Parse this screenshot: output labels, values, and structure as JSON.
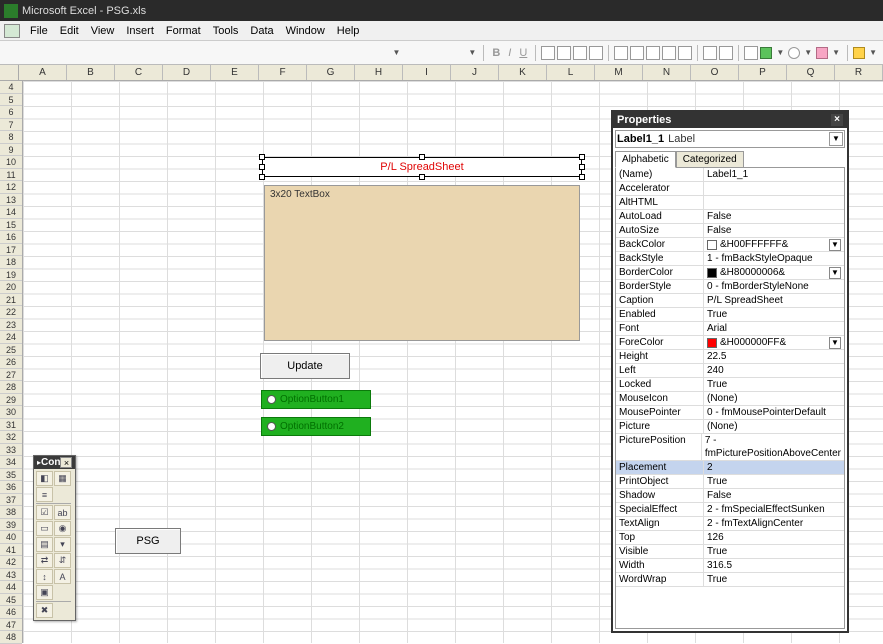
{
  "titlebar": {
    "text": "Microsoft Excel - PSG.xls"
  },
  "menus": [
    "File",
    "Edit",
    "View",
    "Insert",
    "Format",
    "Tools",
    "Data",
    "Window",
    "Help"
  ],
  "columns": [
    "A",
    "B",
    "C",
    "D",
    "E",
    "F",
    "G",
    "H",
    "I",
    "J",
    "K",
    "L",
    "M",
    "N",
    "O",
    "P",
    "Q",
    "R"
  ],
  "row_start": 4,
  "row_end": 48,
  "design": {
    "label_caption": "P/L SpreadSheet",
    "textbox_text": "3x20 TextBox",
    "update_button": "Update",
    "option1": "OptionButton1",
    "option2": "OptionButton2",
    "psg_button": "PSG"
  },
  "toolbox": {
    "title": "Con"
  },
  "properties": {
    "title": "Properties",
    "obj_name": "Label1_1",
    "obj_type": "Label",
    "tabs": [
      "Alphabetic",
      "Categorized"
    ],
    "rows": [
      {
        "name": "(Name)",
        "val": "Label1_1"
      },
      {
        "name": "Accelerator",
        "val": ""
      },
      {
        "name": "AltHTML",
        "val": ""
      },
      {
        "name": "AutoLoad",
        "val": "False"
      },
      {
        "name": "AutoSize",
        "val": "False"
      },
      {
        "name": "BackColor",
        "val": "&H00FFFFFF&",
        "swatch": "white",
        "dd": true
      },
      {
        "name": "BackStyle",
        "val": "1 - fmBackStyleOpaque"
      },
      {
        "name": "BorderColor",
        "val": "&H80000006&",
        "swatch": "black",
        "dd": true
      },
      {
        "name": "BorderStyle",
        "val": "0 - fmBorderStyleNone"
      },
      {
        "name": "Caption",
        "val": "P/L SpreadSheet"
      },
      {
        "name": "Enabled",
        "val": "True"
      },
      {
        "name": "Font",
        "val": "Arial"
      },
      {
        "name": "ForeColor",
        "val": "&H000000FF&",
        "swatch": "red",
        "dd": true
      },
      {
        "name": "Height",
        "val": "22.5"
      },
      {
        "name": "Left",
        "val": "240"
      },
      {
        "name": "Locked",
        "val": "True"
      },
      {
        "name": "MouseIcon",
        "val": "(None)"
      },
      {
        "name": "MousePointer",
        "val": "0 - fmMousePointerDefault"
      },
      {
        "name": "Picture",
        "val": "(None)"
      },
      {
        "name": "PicturePosition",
        "val": "7 - fmPicturePositionAboveCenter"
      },
      {
        "name": "Placement",
        "val": "2",
        "sel": true
      },
      {
        "name": "PrintObject",
        "val": "True"
      },
      {
        "name": "Shadow",
        "val": "False"
      },
      {
        "name": "SpecialEffect",
        "val": "2 - fmSpecialEffectSunken"
      },
      {
        "name": "TextAlign",
        "val": "2 - fmTextAlignCenter"
      },
      {
        "name": "Top",
        "val": "126"
      },
      {
        "name": "Visible",
        "val": "True"
      },
      {
        "name": "Width",
        "val": "316.5"
      },
      {
        "name": "WordWrap",
        "val": "True"
      }
    ]
  }
}
